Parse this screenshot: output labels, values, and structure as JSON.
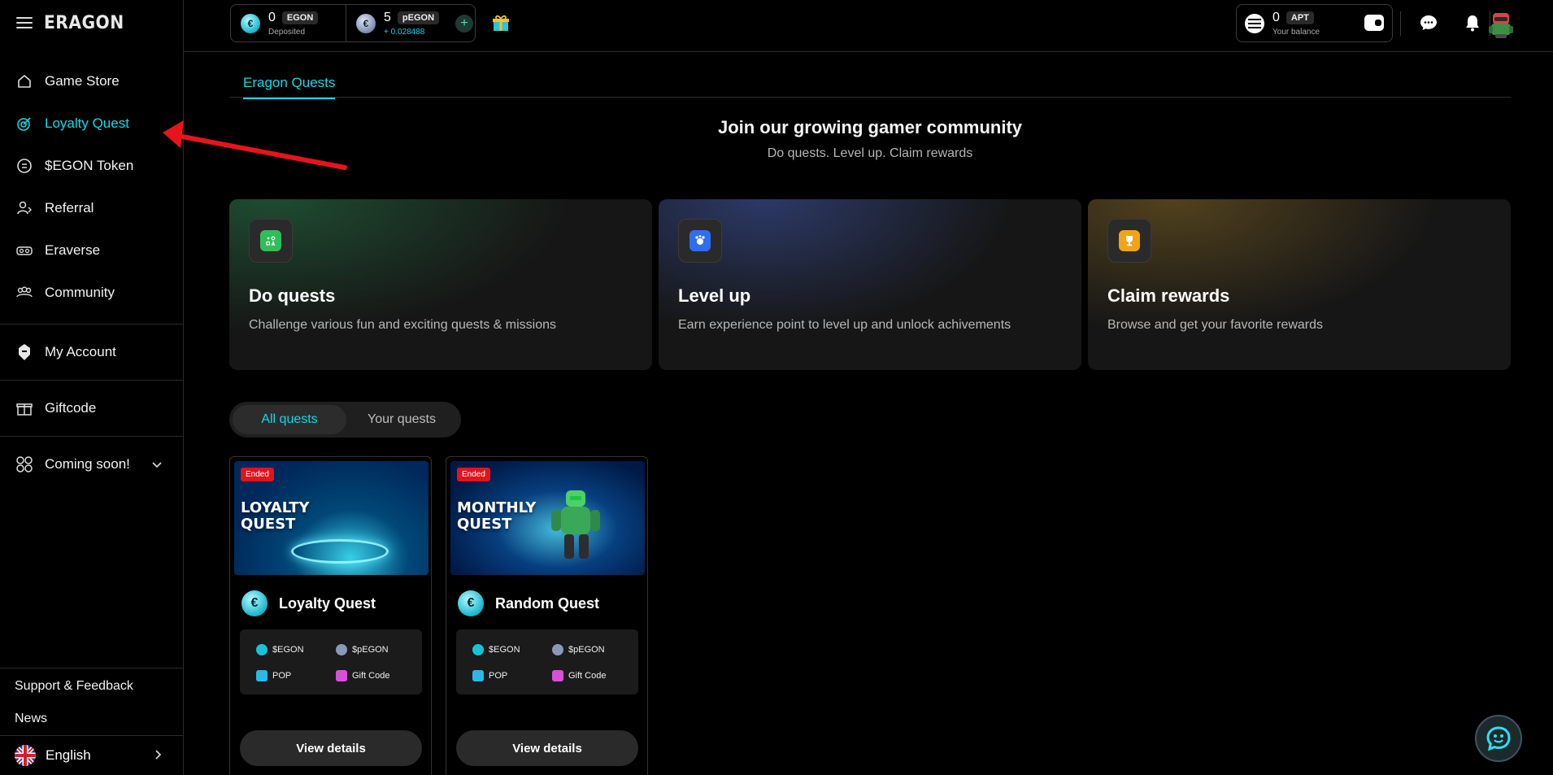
{
  "brand": {
    "logo": "ERAGON"
  },
  "sidebar": {
    "items": [
      {
        "label": "Game Store",
        "icon": "home-icon"
      },
      {
        "label": "Loyalty Quest",
        "icon": "target-icon",
        "active": true
      },
      {
        "label": "$EGON Token",
        "icon": "coin-icon"
      },
      {
        "label": "Referral",
        "icon": "referral-icon"
      },
      {
        "label": "Eraverse",
        "icon": "vr-headset-icon"
      },
      {
        "label": "Community",
        "icon": "community-icon"
      }
    ],
    "account": "My Account",
    "giftcode": "Giftcode",
    "coming_soon": "Coming soon!",
    "support": "Support & Feedback",
    "news": "News",
    "language": "English"
  },
  "topbar": {
    "egon_amount": "0",
    "egon_tag": "EGON",
    "egon_sub": "Deposited",
    "pegon_amount": "5",
    "pegon_tag": "pEGON",
    "pegon_sub": "+ 0.028488",
    "plus": "+",
    "apt_amount": "0",
    "apt_tag": "APT",
    "apt_sub": "Your balance"
  },
  "main": {
    "tab": "Eragon Quests",
    "hero_title": "Join our growing gamer community",
    "hero_sub": "Do quests. Level up. Claim rewards",
    "features": [
      {
        "title": "Do quests",
        "desc": "Challenge various fun and exciting quests & missions"
      },
      {
        "title": "Level up",
        "desc": "Earn experience point to level up and unlock achivements"
      },
      {
        "title": "Claim rewards",
        "desc": "Browse and get your favorite rewards"
      }
    ],
    "filter": {
      "all": "All quests",
      "yours": "Your quests"
    },
    "cards": [
      {
        "badge": "Ended",
        "image_line1": "LOYALTY",
        "image_line2": "QUEST",
        "title": "Loyalty Quest",
        "rewards": [
          "$EGON",
          "$pEGON",
          "POP",
          "Gift Code"
        ],
        "button": "View details"
      },
      {
        "badge": "Ended",
        "image_line1": "MONTHLY",
        "image_line2": "QUEST",
        "title": "Random Quest",
        "rewards": [
          "$EGON",
          "$pEGON",
          "POP",
          "Gift Code"
        ],
        "button": "View details"
      }
    ]
  },
  "colors": {
    "accent": "#14d9e6",
    "ended": "#e0151b",
    "annotation_arrow": "#e8141b"
  }
}
